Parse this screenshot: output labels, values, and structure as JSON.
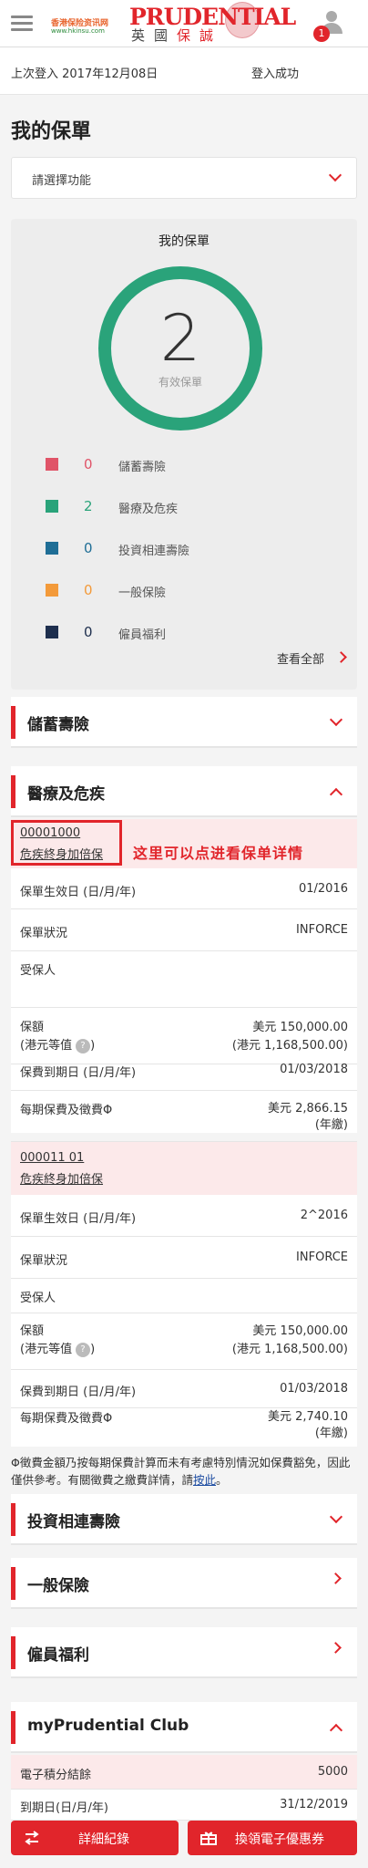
{
  "header": {
    "watermark_top": "香港保险资讯网",
    "watermark_bottom": "www.hkinsu.com",
    "brand_name": "PRUDENTIAL",
    "brand_sub_1": "英",
    "brand_sub_2": "國",
    "brand_sub_3": "保",
    "brand_sub_4": "誠",
    "notification_count": "1"
  },
  "login": {
    "last_login": "上次登入 2017年12月08日",
    "status": "登入成功"
  },
  "page_title": "我的保單",
  "function_select": {
    "value": "請選擇功能"
  },
  "summary": {
    "title": "我的保單",
    "total": "2",
    "total_label": "有效保單",
    "legend": [
      {
        "color": "#e05468",
        "count": "0",
        "label": "儲蓄壽險"
      },
      {
        "color": "#2aa37a",
        "count": "2",
        "label": "醫療及危疾"
      },
      {
        "color": "#1f6e96",
        "count": "0",
        "label": "投資相連壽險"
      },
      {
        "color": "#f39a3a",
        "count": "0",
        "label": "一般保險"
      },
      {
        "color": "#1e2f4e",
        "count": "0",
        "label": "僱員福利"
      }
    ],
    "view_all": "查看全部"
  },
  "sections": {
    "savings": "儲蓄壽險",
    "medical": "醫療及危疾",
    "investment": "投資相連壽險",
    "general": "一般保險",
    "employee": "僱員福利",
    "club": "myPrudential Club"
  },
  "annotation": "这里可以点进看保单详情",
  "policies": [
    {
      "number": "00001000",
      "name": "危疾終身加倍保",
      "effective_label": "保單生效日 (日/月/年)",
      "effective_value": "01/2016",
      "status_label": "保單狀況",
      "status_value": "INFORCE",
      "insured_label": "受保人",
      "insured_value": "",
      "amount_label_1": "保額",
      "amount_label_2": "(港元等值",
      "amount_value_1": "美元 150,000.00",
      "amount_value_2": "(港元 1,168,500.00)",
      "expiry_label": "保費到期日 (日/月/年)",
      "expiry_value": "01/03/2018",
      "premium_label": "每期保費及徵費Φ",
      "premium_value_1": "美元 2,866.15",
      "premium_value_2": "(年繳)"
    },
    {
      "number": "000011 0​1",
      "name": "危疾終身加倍保",
      "effective_label": "保單生效日 (日/月/年)",
      "effective_value": "2^2016",
      "status_label": "保單狀況",
      "status_value": "INFORCE",
      "insured_label": "受保人",
      "insured_value": "",
      "amount_label_1": "保額",
      "amount_label_2": "(港元等值",
      "amount_value_1": "美元 150,000.00",
      "amount_value_2": "(港元 1,168,500.00)",
      "expiry_label": "保費到期日 (日/月/年)",
      "expiry_value": "01/03/2018",
      "premium_label": "每期保費及徵費Φ",
      "premium_value_1": "美元 2,740.10",
      "premium_value_2": "(年繳)"
    }
  ],
  "note": {
    "text": "Φ徵費金額乃按每期保費計算而未有考慮特別情況如保費豁免，因此僅供參考。有關徵費之繳費詳情，請",
    "link": "按此",
    "end": "。"
  },
  "club": {
    "points_label": "電子積分結餘",
    "points_value": "5000",
    "expiry_label": "到期日(日/月/年)",
    "expiry_value": "31/12/2019"
  },
  "buttons": {
    "details": "詳細紀錄",
    "redeem": "換領電子優惠券"
  },
  "colors": {
    "brand_red": "#e1252b",
    "ring_green": "#2aa37a",
    "highlight_pink": "#fce9ea"
  }
}
